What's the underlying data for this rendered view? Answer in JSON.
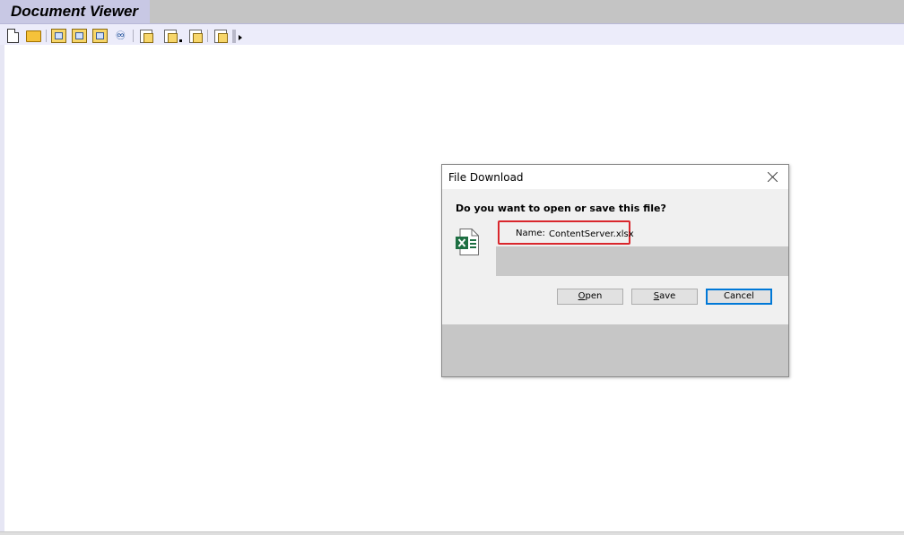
{
  "app": {
    "title": "Document Viewer"
  },
  "toolbar": {
    "buttons": [
      {
        "name": "new-document-button",
        "icon": "blank-page-icon"
      },
      {
        "name": "open-folder-button",
        "icon": "folder-icon"
      },
      {
        "name": "toolbar-button-3",
        "icon": "document-box-icon"
      },
      {
        "name": "toolbar-button-4",
        "icon": "settings-box-icon"
      },
      {
        "name": "toolbar-button-5",
        "icon": "edit-box-icon"
      },
      {
        "name": "find-button",
        "icon": "binoculars-icon"
      },
      {
        "name": "toolbar-button-7",
        "icon": "copy-icon"
      },
      {
        "name": "toolbar-button-8",
        "icon": "copy-dropdown-icon"
      },
      {
        "name": "toolbar-button-9",
        "icon": "page-add-icon"
      },
      {
        "name": "toolbar-button-10",
        "icon": "page-up-icon"
      }
    ]
  },
  "dialog": {
    "title": "File Download",
    "question": "Do you want to open or save this file?",
    "file": {
      "label": "Name:",
      "value": "ContentServer.xlsx",
      "icon": "excel-file-icon"
    },
    "buttons": {
      "open_accel": "O",
      "open_rest": "pen",
      "save_accel": "S",
      "save_rest": "ave",
      "cancel": "Cancel"
    }
  },
  "colors": {
    "title_tab": "#c8c8e4",
    "toolbar": "#ececfa",
    "highlight": "#d9262c",
    "default_button_border": "#0078d7",
    "excel_green": "#1d6f42"
  }
}
